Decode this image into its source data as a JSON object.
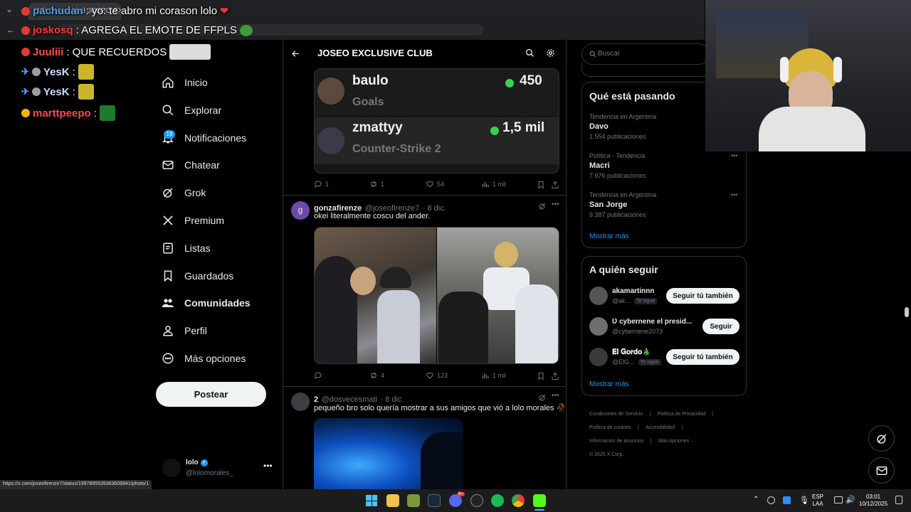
{
  "browser": {
    "tab_title": "(19) Comunidad JOSEO EXCLUS"
  },
  "chat": [
    {
      "user": "pachudan",
      "message": ": yo: te abro mi corason lolo",
      "user_color": "#4f9dde",
      "badge_color": "#e53935",
      "emote": "heart"
    },
    {
      "user": "joskosq",
      "message": ": AGREGA EL EMOTE DE FFPLS",
      "user_color": "#ff3b3b",
      "badge_color": "#e53935",
      "emote": "pepe"
    },
    {
      "user": "Juuliii",
      "message": ": QUE RECUERDOS",
      "user_color": "#ff4d4d",
      "badge_color": "#e53935",
      "emote": "photo"
    },
    {
      "user": "YesK",
      "message": ":",
      "user_color": "#cfd8ff",
      "badge_color": "#9e9e9e",
      "emote": "yellow"
    },
    {
      "user": "YesK",
      "message": ":",
      "user_color": "#cfd8ff",
      "badge_color": "#9e9e9e",
      "emote": "yellow"
    },
    {
      "user": "marttpeepo",
      "message": ":",
      "user_color": "#ff4757",
      "badge_color": "#f5b400",
      "emote": "green"
    }
  ],
  "nav": {
    "items": [
      {
        "label": "Inicio",
        "icon": "home-icon"
      },
      {
        "label": "Explorar",
        "icon": "search-icon"
      },
      {
        "label": "Notificaciones",
        "icon": "bell-icon"
      },
      {
        "label": "Chatear",
        "icon": "mail-icon"
      },
      {
        "label": "Grok",
        "icon": "grok-icon"
      },
      {
        "label": "Premium",
        "icon": "x-logo-icon"
      },
      {
        "label": "Listas",
        "icon": "list-icon"
      },
      {
        "label": "Guardados",
        "icon": "bookmark-icon"
      },
      {
        "label": "Comunidades",
        "icon": "communities-icon"
      },
      {
        "label": "Perfil",
        "icon": "person-icon"
      },
      {
        "label": "Más opciones",
        "icon": "more-circle-icon"
      }
    ],
    "notifications_count": "19",
    "post_label": "Postear"
  },
  "account": {
    "name": "lolo",
    "handle": "@lolomorales_"
  },
  "header": {
    "title": "JOSEO EXCLUSIVE CLUB"
  },
  "tweets": [
    {
      "embedded_rows": [
        {
          "name": "baulo",
          "value": "450",
          "sub": "Goals"
        },
        {
          "name": "zmattyy",
          "value": "1,5 mil",
          "sub": "Counter-Strike 2"
        }
      ],
      "actions": {
        "replies": "1",
        "retweets": "1",
        "likes": "54",
        "views": "1 mil"
      }
    },
    {
      "avatar_letter": "g",
      "name": "gonzafirenze",
      "handle": "@joseofirenze7",
      "date": "· 8 dic.",
      "text": "okei literalmente coscu del ander.",
      "actions": {
        "replies": "",
        "retweets": "4",
        "likes": "123",
        "views": "1 mil"
      }
    },
    {
      "name": "2",
      "handle": "@dosvecesmati",
      "date": "· 8 dic.",
      "text": "pequeño bro solo quería mostrar a sus amigos que vió a lolo morales 🥀"
    }
  ],
  "right": {
    "search_placeholder": "Buscar",
    "trends_title": "Qué está pasando",
    "trends": [
      {
        "meta": "Tendencia en Argentina",
        "name": "Davo",
        "count": "1.554 publicaciones"
      },
      {
        "meta": "Política · Tendencia",
        "name": "Macri",
        "count": "7.976 publicaciones"
      },
      {
        "meta": "Tendencia en Argentina",
        "name": "San Jorge",
        "count": "9.387 publicaciones"
      }
    ],
    "show_more": "Mostrar más",
    "follow_title": "A quién seguir",
    "follow": [
      {
        "name": "akamartinnn",
        "handle": "@ak...",
        "follows_you": "Te sigue",
        "button": "Seguir tú también"
      },
      {
        "name": "Ʋ cybernene el presid...",
        "handle": "@cybernene2073",
        "follows_you": "",
        "button": "Seguir"
      },
      {
        "name": "𝐄𝐥 𝐆𝐨𝐫𝐝𝐨🎄",
        "handle": "@ElG...",
        "follows_you": "Te sigue",
        "button": "Seguir tú también"
      }
    ],
    "show_more_2": "Mostrar más",
    "footer": [
      "Condiciones de Servicio",
      "Política de Privacidad",
      "Política de cookies",
      "Accesibilidad",
      "Información de anuncios",
      "Más opciones ···",
      "© 2025 X Corp."
    ]
  },
  "status_url": "https://x.com/joseofirenze7/status/1997895539363606841/photo/1",
  "taskbar": {
    "lang_top": "ESP",
    "lang_bottom": "LAA",
    "time": "03:01",
    "date": "10/12/2025",
    "discord_badge": "9+"
  }
}
